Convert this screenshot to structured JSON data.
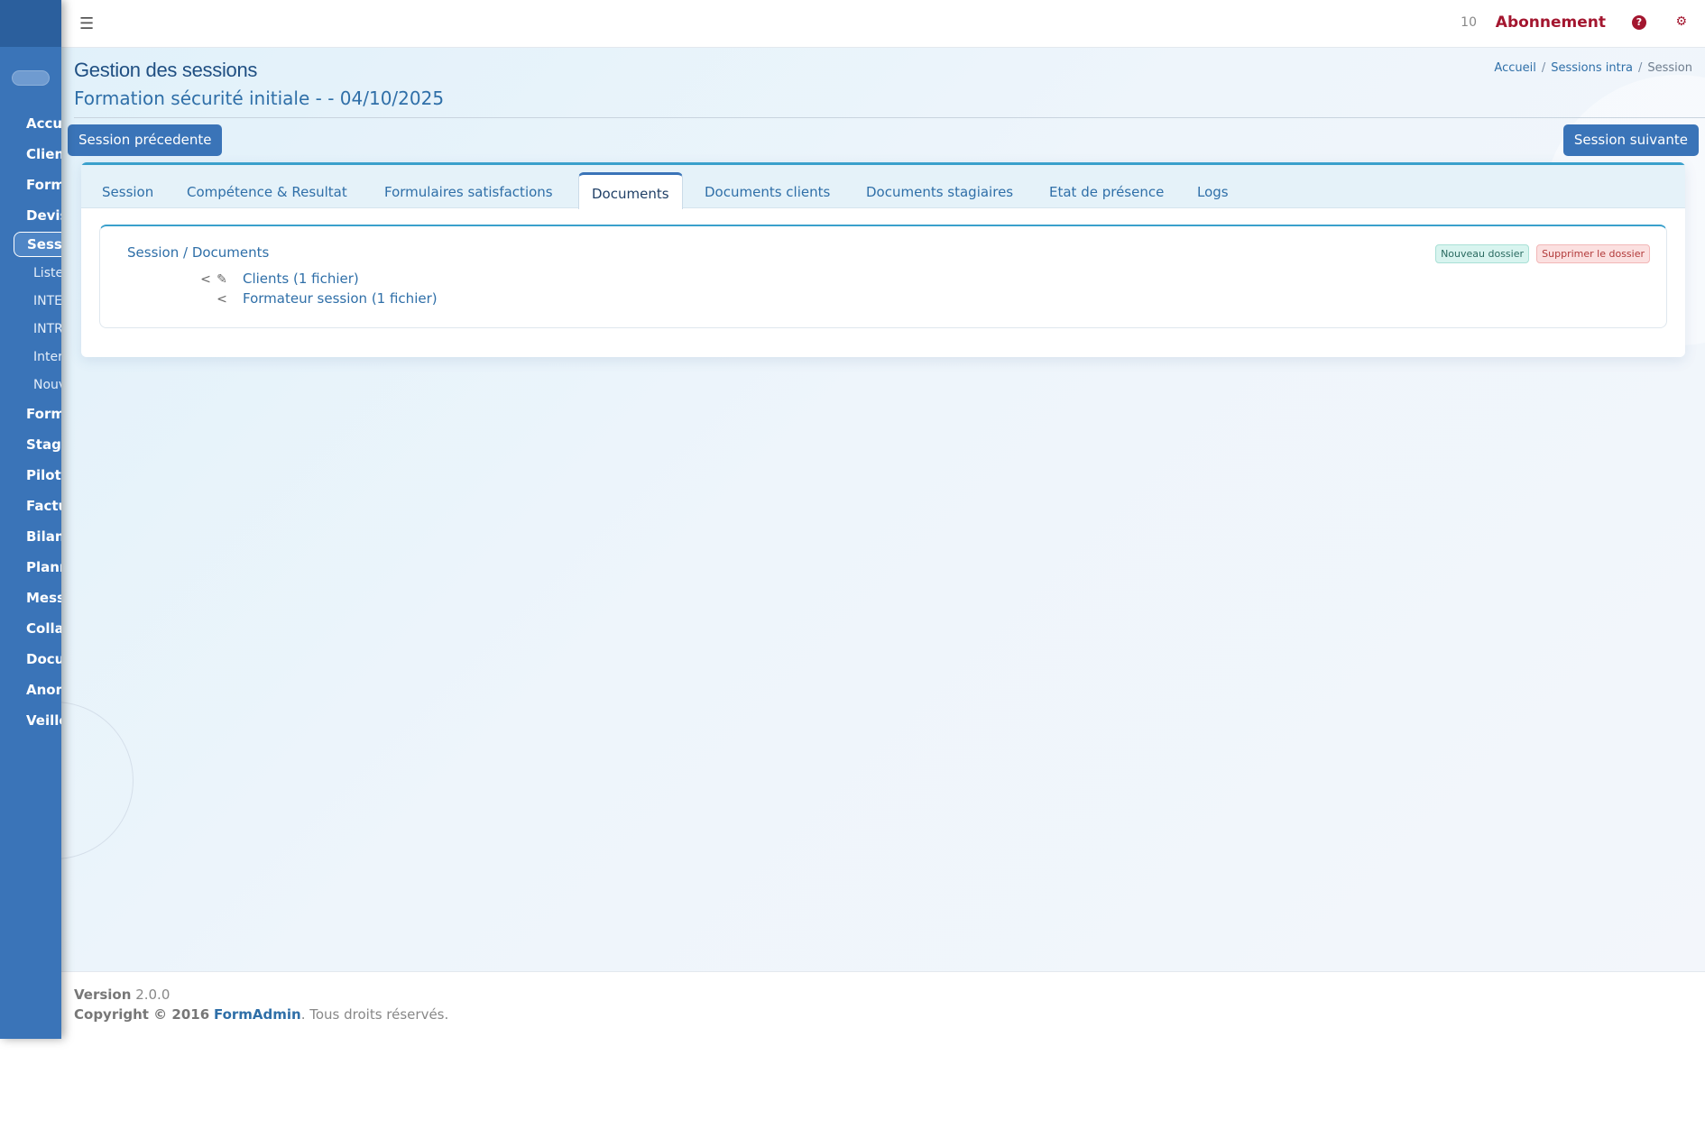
{
  "topbar": {
    "count": "10",
    "subscription": "Abonnement"
  },
  "sidebar": {
    "items": [
      {
        "label": "Accueil"
      },
      {
        "label": "Clients"
      },
      {
        "label": "Formations"
      },
      {
        "label": "Devis"
      },
      {
        "label": "Sessions"
      },
      {
        "label": "Formateurs"
      },
      {
        "label": "Stagiaires"
      },
      {
        "label": "Pilotage"
      },
      {
        "label": "Facturation"
      },
      {
        "label": "Bilan"
      },
      {
        "label": "Planning"
      },
      {
        "label": "Messagerie"
      },
      {
        "label": "Collaborateurs"
      },
      {
        "label": "Documents"
      },
      {
        "label": "Anomalies"
      },
      {
        "label": "Veille"
      }
    ],
    "subitems": [
      {
        "label": "Liste"
      },
      {
        "label": "INTER"
      },
      {
        "label": "INTRA"
      },
      {
        "label": "Interne"
      },
      {
        "label": "Nouvelle"
      }
    ]
  },
  "header": {
    "title": "Gestion des sessions",
    "subtitle": "Formation sécurité initiale - - 04/10/2025",
    "breadcrumb": [
      "Accueil",
      "Sessions intra",
      "Session"
    ]
  },
  "nav_buttons": {
    "prev": "Session précedente",
    "next": "Session suivante"
  },
  "tabs": [
    {
      "label": "Session"
    },
    {
      "label": "Compétence & Resultat"
    },
    {
      "label": "Formulaires satisfactions"
    },
    {
      "label": "Documents"
    },
    {
      "label": "Documents clients"
    },
    {
      "label": "Documents stagiaires"
    },
    {
      "label": "Etat de présence"
    },
    {
      "label": "Logs"
    }
  ],
  "active_tab": "Documents",
  "documents": {
    "path": "Session / Documents",
    "new_folder": "Nouveau dossier",
    "delete_folder": "Supprimer le dossier",
    "folders": [
      {
        "label": "Clients (1 fichier)",
        "icons": [
          "share-icon",
          "pencil-icon"
        ]
      },
      {
        "label": "Formateur session (1 fichier)",
        "icons": [
          "share-icon"
        ]
      }
    ]
  },
  "footer": {
    "version_label": "Version",
    "version": "2.0.0",
    "copyright": "Copyright © 2016",
    "brand": "FormAdmin",
    "rights": ". Tous droits réservés."
  }
}
